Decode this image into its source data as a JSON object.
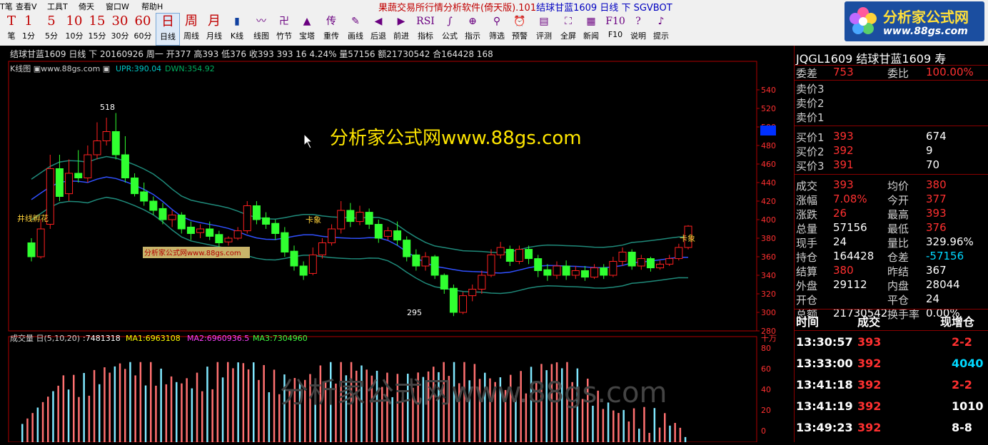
{
  "menu": [
    "T笔",
    "查看V",
    "工具T",
    "倚天",
    "窗口W",
    "帮助H"
  ],
  "app_title": {
    "part1": "果蔬交易所行情分析软件(倚天版).101",
    "part2": "结球甘蓝1609 日线 下 SGVBOT"
  },
  "toolbar": [
    {
      "icon": "T",
      "label": "笔"
    },
    {
      "icon": "1",
      "label": "1分"
    },
    {
      "icon": "5",
      "label": "5分"
    },
    {
      "icon": "10",
      "label": "10分"
    },
    {
      "icon": "15",
      "label": "15分"
    },
    {
      "icon": "30",
      "label": "30分"
    },
    {
      "icon": "60",
      "label": "60分"
    },
    {
      "icon": "日",
      "label": "日线"
    },
    {
      "icon": "周",
      "label": "周线"
    },
    {
      "icon": "月",
      "label": "月线"
    },
    {
      "icon": "▮",
      "label": "K线"
    },
    {
      "icon": "〰",
      "label": "线图"
    },
    {
      "icon": "卍",
      "label": "竹节"
    },
    {
      "icon": "▲",
      "label": "宝塔"
    },
    {
      "icon": "传",
      "label": "重传"
    },
    {
      "icon": "✎",
      "label": "画线"
    },
    {
      "icon": "◀",
      "label": "后退"
    },
    {
      "icon": "▶",
      "label": "前进"
    },
    {
      "icon": "RSI",
      "label": "指标"
    },
    {
      "icon": "∫",
      "label": "公式"
    },
    {
      "icon": "⊕",
      "label": "指示"
    },
    {
      "icon": "⚲",
      "label": "筛选"
    },
    {
      "icon": "⏰",
      "label": "预警"
    },
    {
      "icon": "▤",
      "label": "评测"
    },
    {
      "icon": "⛶",
      "label": "全屏"
    },
    {
      "icon": "▦",
      "label": "新闻"
    },
    {
      "icon": "F10",
      "label": "F10"
    },
    {
      "icon": "?",
      "label": "说明"
    },
    {
      "icon": "♪",
      "label": "提示"
    }
  ],
  "logo": {
    "line1": "分析家公式网",
    "line2": "www.88gs.com"
  },
  "chart_info": {
    "header": "结球甘蓝1609 日线 下 20160926 周一 开377 高393 低376 收393 393 16 4.24% 量57156 额21730542 合164428 168",
    "kline_label": "K线图 ▣www.88gs.com ▣",
    "upr": "UPR:390.04",
    "dwn": "DWN:354.92",
    "high_label": "518",
    "low_label": "295",
    "signal_left": "井线孵花",
    "signal_mid": "卡象",
    "signal_right": "卡象",
    "watermark": "分析家公式网www.88gs.com",
    "small_watermark": "分析家公式网www.88gs.com",
    "vol_watermark": "分析家公式网www.88gs.com",
    "price_ticks": [
      "540",
      "520",
      "500",
      "480",
      "460",
      "440",
      "420",
      "400",
      "380",
      "360",
      "340",
      "320",
      "300",
      "280"
    ],
    "vol_label": "成交量 日(5,10,20)",
    "vol_value": ":7481318",
    "ma1": "MA1:6963108",
    "ma2": "MA2:6960936.5",
    "ma3": "MA3:7304960",
    "vol_unit": "十万",
    "vol_ticks": [
      "80",
      "60",
      "40",
      "20",
      "0"
    ]
  },
  "quote": {
    "symbol": "JQGL1609  结球甘蓝1609  寿",
    "wc_label": "委差",
    "wc": "753",
    "wb_label": "委比",
    "wb": "100.00%",
    "asks": [
      {
        "l": "卖价3",
        "p": "",
        "v": ""
      },
      {
        "l": "卖价2",
        "p": "",
        "v": ""
      },
      {
        "l": "卖价1",
        "p": "",
        "v": ""
      }
    ],
    "bids": [
      {
        "l": "买价1",
        "p": "393",
        "v": "674"
      },
      {
        "l": "买价2",
        "p": "392",
        "v": "9"
      },
      {
        "l": "买价3",
        "p": "391",
        "v": "70"
      }
    ],
    "stats": [
      {
        "l1": "成交",
        "v1": "393",
        "c1": "red",
        "l2": "均价",
        "v2": "380",
        "c2": "red"
      },
      {
        "l1": "涨幅",
        "v1": "7.08%",
        "c1": "red",
        "l2": "今开",
        "v2": "377",
        "c2": "red"
      },
      {
        "l1": "涨跌",
        "v1": "26",
        "c1": "red",
        "l2": "最高",
        "v2": "393",
        "c2": "red"
      },
      {
        "l1": "总量",
        "v1": "57156",
        "c1": "wht",
        "l2": "最低",
        "v2": "376",
        "c2": "red"
      },
      {
        "l1": "现手",
        "v1": "24",
        "c1": "wht",
        "l2": "量比",
        "v2": "329.96%",
        "c2": "wht"
      },
      {
        "l1": "持仓",
        "v1": "164428",
        "c1": "wht",
        "l2": "仓差",
        "v2": "-57156",
        "c2": "cyn"
      },
      {
        "l1": "结算",
        "v1": "380",
        "c1": "red",
        "l2": "昨结",
        "v2": "367",
        "c2": "wht"
      },
      {
        "l1": "外盘",
        "v1": "29112",
        "c1": "wht",
        "l2": "内盘",
        "v2": "28044",
        "c2": "wht"
      },
      {
        "l1": "开仓",
        "v1": "",
        "c1": "wht",
        "l2": "平仓",
        "v2": "24",
        "c2": "wht"
      },
      {
        "l1": "总额",
        "v1": "21730542",
        "c1": "wht",
        "l2": "换手率",
        "v2": "0.00%",
        "c2": "wht"
      }
    ],
    "tick_header": {
      "time": "时间",
      "price": "成交",
      "vol": "现增仓"
    },
    "ticks": [
      {
        "t": "13:30:57",
        "p": "393",
        "v": "2-2",
        "c": "red"
      },
      {
        "t": "13:33:00",
        "p": "392",
        "v": "4040",
        "c": "cyn"
      },
      {
        "t": "13:41:18",
        "p": "392",
        "v": "2-2",
        "c": "red"
      },
      {
        "t": "13:41:19",
        "p": "392",
        "v": "1010",
        "c": "wht"
      },
      {
        "t": "13:49:23",
        "p": "392",
        "v": "8-8",
        "c": "wht"
      }
    ]
  },
  "chart_data": {
    "type": "candlestick",
    "title": "结球甘蓝1609 日线",
    "price_range": [
      280,
      540
    ],
    "candles": [
      [
        375,
        380,
        360,
        355
      ],
      [
        360,
        400,
        390,
        358
      ],
      [
        395,
        470,
        455,
        390
      ],
      [
        455,
        470,
        425,
        420
      ],
      [
        428,
        465,
        450,
        420
      ],
      [
        450,
        475,
        445,
        440
      ],
      [
        445,
        480,
        470,
        440
      ],
      [
        470,
        505,
        485,
        465
      ],
      [
        485,
        510,
        495,
        480
      ],
      [
        495,
        515,
        470,
        465
      ],
      [
        470,
        490,
        445,
        440
      ],
      [
        445,
        450,
        428,
        425
      ],
      [
        430,
        440,
        420,
        415
      ],
      [
        420,
        425,
        410,
        405
      ],
      [
        412,
        418,
        400,
        395
      ],
      [
        400,
        410,
        405,
        392
      ],
      [
        405,
        408,
        390,
        385
      ],
      [
        392,
        398,
        385,
        378
      ],
      [
        386,
        395,
        390,
        380
      ],
      [
        390,
        398,
        382,
        378
      ],
      [
        384,
        388,
        375,
        370
      ],
      [
        376,
        382,
        380,
        372
      ],
      [
        380,
        392,
        388,
        378
      ],
      [
        388,
        420,
        415,
        385
      ],
      [
        415,
        420,
        400,
        395
      ],
      [
        402,
        408,
        395,
        390
      ],
      [
        396,
        400,
        385,
        378
      ],
      [
        386,
        392,
        365,
        360
      ],
      [
        366,
        372,
        350,
        345
      ],
      [
        350,
        355,
        340,
        335
      ],
      [
        342,
        370,
        362,
        340
      ],
      [
        362,
        380,
        375,
        358
      ],
      [
        375,
        395,
        390,
        372
      ],
      [
        390,
        420,
        410,
        385
      ],
      [
        410,
        418,
        398,
        392
      ],
      [
        398,
        415,
        408,
        394
      ],
      [
        408,
        412,
        395,
        390
      ],
      [
        395,
        400,
        380,
        375
      ],
      [
        382,
        392,
        388,
        378
      ],
      [
        388,
        398,
        378,
        372
      ],
      [
        378,
        382,
        360,
        355
      ],
      [
        362,
        368,
        350,
        345
      ],
      [
        350,
        365,
        360,
        345
      ],
      [
        360,
        362,
        340,
        336
      ],
      [
        340,
        342,
        325,
        320
      ],
      [
        326,
        330,
        300,
        296
      ],
      [
        300,
        322,
        318,
        298
      ],
      [
        318,
        330,
        325,
        312
      ],
      [
        325,
        345,
        340,
        320
      ],
      [
        340,
        368,
        362,
        338
      ],
      [
        362,
        376,
        370,
        358
      ],
      [
        368,
        372,
        355,
        350
      ],
      [
        355,
        372,
        368,
        352
      ],
      [
        368,
        372,
        358,
        352
      ],
      [
        358,
        362,
        345,
        338
      ],
      [
        346,
        352,
        340,
        334
      ],
      [
        340,
        355,
        350,
        336
      ],
      [
        350,
        356,
        340,
        335
      ],
      [
        340,
        350,
        345,
        336
      ],
      [
        345,
        350,
        338,
        334
      ],
      [
        338,
        352,
        348,
        336
      ],
      [
        348,
        352,
        340,
        336
      ],
      [
        340,
        360,
        355,
        338
      ],
      [
        355,
        370,
        365,
        350
      ],
      [
        365,
        368,
        350,
        346
      ],
      [
        350,
        362,
        358,
        346
      ],
      [
        358,
        360,
        348,
        344
      ],
      [
        348,
        356,
        352,
        346
      ],
      [
        352,
        362,
        358,
        350
      ],
      [
        358,
        374,
        370,
        356
      ],
      [
        370,
        394,
        393,
        368
      ]
    ],
    "upper_band_approx": "UPR 390.04",
    "lower_band_approx": "DWN 354.92",
    "volume_ma": {
      "MA1": 6963108,
      "MA2": 6960936.5,
      "MA3": 7304960
    },
    "volume_last": 7481318,
    "volume_unit": "十万"
  }
}
